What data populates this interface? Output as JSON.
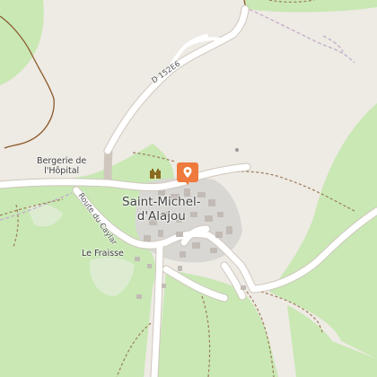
{
  "colors": {
    "background": "#eeeae4",
    "forest": "#c9e8b4",
    "road": "#ffffff",
    "road_casing": "#cfc7bd",
    "village": "#d9d7d4",
    "path": "#9c7b58",
    "track": "#c3aecb",
    "pin": "#ee7a3d",
    "contour": "#8b5a2b"
  },
  "icons": {
    "pin": "map-pin-icon",
    "castle": "castle-icon"
  },
  "labels": {
    "town": [
      "Saint-Michel-",
      "d'Alajou"
    ],
    "bergerie": [
      "Bergerie de",
      "l'Hôpital"
    ],
    "le_fraisse": "Le Fraisse",
    "road_d152e6": "D 152E6",
    "road_caylar": "Route du Caylar"
  }
}
